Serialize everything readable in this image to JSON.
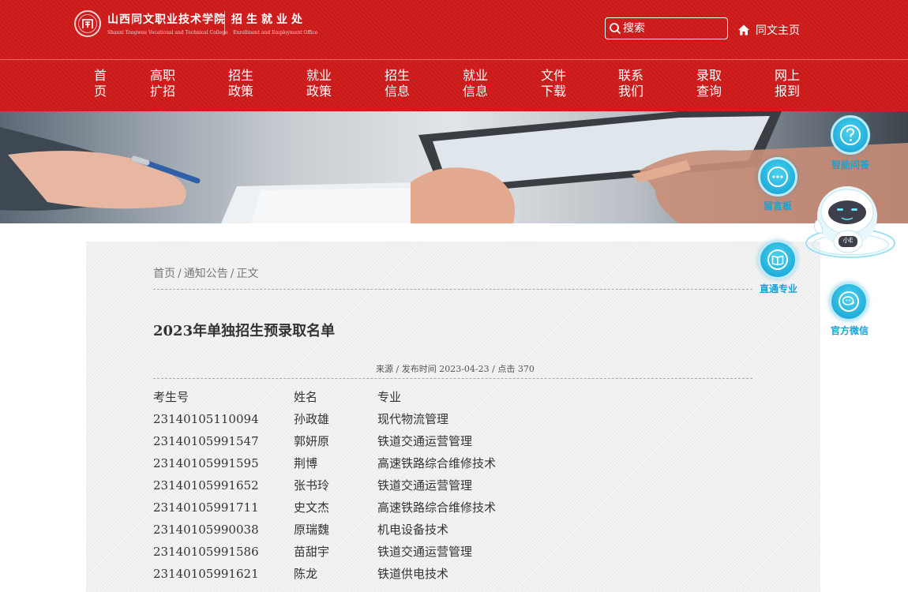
{
  "header": {
    "school_name_cn": "山西同文职业技术学院",
    "school_name_en": "Shanxi Tongwen Vocational and Technical College",
    "office_name_cn": "招生就业处",
    "office_name_en": "Enrollment and Employment Office",
    "search_placeholder": "搜索",
    "home_link": "同文主页"
  },
  "nav": [
    {
      "line1": "首",
      "line2": "页"
    },
    {
      "line1": "高职",
      "line2": "扩招"
    },
    {
      "line1": "招生",
      "line2": "政策"
    },
    {
      "line1": "就业",
      "line2": "政策"
    },
    {
      "line1": "招生",
      "line2": "信息"
    },
    {
      "line1": "就业",
      "line2": "信息"
    },
    {
      "line1": "文件",
      "line2": "下载"
    },
    {
      "line1": "联系",
      "line2": "我们"
    },
    {
      "line1": "录取",
      "line2": "查询"
    },
    {
      "line1": "网上",
      "line2": "报到"
    }
  ],
  "breadcrumb": [
    "首页",
    "通知公告",
    "正文"
  ],
  "breadcrumb_sep": "/",
  "article": {
    "title": "2023年单独招生预录取名单",
    "source_label": "来源",
    "date_label": "发布时间",
    "date": "2023-04-23",
    "hits_label": "点击",
    "hits": "370",
    "meta_sep": "/"
  },
  "table": {
    "headers": [
      "考生号",
      "姓名",
      "专业"
    ],
    "rows": [
      [
        "23140105110094",
        "孙政雄",
        "现代物流管理"
      ],
      [
        "23140105991547",
        "郭妍原",
        "铁道交通运营管理"
      ],
      [
        "23140105991595",
        "荆博",
        "高速铁路综合维修技术"
      ],
      [
        "23140105991652",
        "张书玲",
        "铁道交通运营管理"
      ],
      [
        "23140105991711",
        "史文杰",
        "高速铁路综合维修技术"
      ],
      [
        "23140105990038",
        "原瑞魏",
        "机电设备技术"
      ],
      [
        "23140105991586",
        "苗甜宇",
        "铁道交通运营管理"
      ],
      [
        "23140105991621",
        "陈龙",
        "铁道供电技术"
      ]
    ]
  },
  "widgets": {
    "smart_qa": "智能问答",
    "message_board": "留言板",
    "majors": "直通专业",
    "wechat": "官方微信",
    "robot_badge": "小E"
  },
  "colors": {
    "brand_red": "#cf1a1a",
    "widget_blue": "#22aedb",
    "widget_label": "#1e9fd3"
  }
}
